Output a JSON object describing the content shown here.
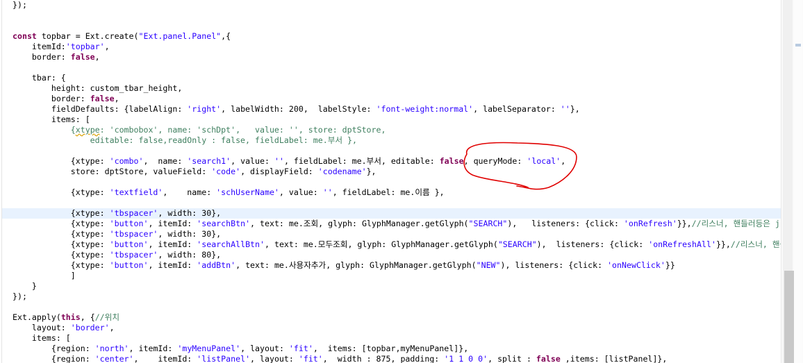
{
  "editor": {
    "lines": [
      {
        "segments": [
          {
            "t": "});",
            "c": "pl"
          }
        ]
      },
      {
        "segments": []
      },
      {
        "segments": []
      },
      {
        "segments": [
          {
            "t": "const",
            "c": "kw"
          },
          {
            "t": " topbar = Ext.create(",
            "c": "pl"
          },
          {
            "t": "\"Ext.panel.Panel\"",
            "c": "str"
          },
          {
            "t": ",{",
            "c": "pl"
          }
        ]
      },
      {
        "segments": [
          {
            "t": "    itemId:",
            "c": "pl"
          },
          {
            "t": "'topbar'",
            "c": "str"
          },
          {
            "t": ",",
            "c": "pl"
          }
        ]
      },
      {
        "segments": [
          {
            "t": "    border: ",
            "c": "pl"
          },
          {
            "t": "false",
            "c": "kw"
          },
          {
            "t": ",",
            "c": "pl"
          }
        ]
      },
      {
        "segments": []
      },
      {
        "segments": [
          {
            "t": "    tbar: {",
            "c": "pl"
          }
        ]
      },
      {
        "segments": [
          {
            "t": "        height: custom_tbar_height,",
            "c": "pl"
          }
        ]
      },
      {
        "segments": [
          {
            "t": "        border: ",
            "c": "pl"
          },
          {
            "t": "false",
            "c": "kw"
          },
          {
            "t": ",",
            "c": "pl"
          }
        ]
      },
      {
        "segments": [
          {
            "t": "        fieldDefaults: {labelAlign: ",
            "c": "pl"
          },
          {
            "t": "'right'",
            "c": "str"
          },
          {
            "t": ", labelWidth: 200,  labelStyle: ",
            "c": "pl"
          },
          {
            "t": "'font-weight:normal'",
            "c": "str"
          },
          {
            "t": ", labelSeparator: ",
            "c": "pl"
          },
          {
            "t": "''",
            "c": "str"
          },
          {
            "t": "},",
            "c": "pl"
          }
        ]
      },
      {
        "segments": [
          {
            "t": "        items: [",
            "c": "pl"
          }
        ]
      },
      {
        "segments": [
          {
            "t": "            {",
            "c": "cm"
          },
          {
            "t": "xtype",
            "c": "cmsq"
          },
          {
            "t": ": 'combobox', name: 'schDpt',   value: '', store: dptStore,",
            "c": "cm"
          }
        ]
      },
      {
        "segments": [
          {
            "t": "                editable: false,readOnly : false, fieldLabel: me.부서 },",
            "c": "cm"
          }
        ]
      },
      {
        "segments": []
      },
      {
        "segments": [
          {
            "t": "            {xtype: ",
            "c": "pl"
          },
          {
            "t": "'combo'",
            "c": "str"
          },
          {
            "t": ",  name: ",
            "c": "pl"
          },
          {
            "t": "'search1'",
            "c": "str"
          },
          {
            "t": ", value: ",
            "c": "pl"
          },
          {
            "t": "''",
            "c": "str"
          },
          {
            "t": ", fieldLabel: me.부서, editable: ",
            "c": "pl"
          },
          {
            "t": "false",
            "c": "kw"
          },
          {
            "t": ", queryMode: ",
            "c": "pl"
          },
          {
            "t": "'local'",
            "c": "str"
          },
          {
            "t": ",",
            "c": "pl"
          }
        ]
      },
      {
        "segments": [
          {
            "t": "            store: dptStore, valueField: ",
            "c": "pl"
          },
          {
            "t": "'code'",
            "c": "str"
          },
          {
            "t": ", displayField: ",
            "c": "pl"
          },
          {
            "t": "'codename'",
            "c": "str"
          },
          {
            "t": "},",
            "c": "pl"
          }
        ]
      },
      {
        "segments": []
      },
      {
        "segments": [
          {
            "t": "            {xtype: ",
            "c": "pl"
          },
          {
            "t": "'textfield'",
            "c": "str"
          },
          {
            "t": ",    name: ",
            "c": "pl"
          },
          {
            "t": "'schUserName'",
            "c": "str"
          },
          {
            "t": ", value: ",
            "c": "pl"
          },
          {
            "t": "''",
            "c": "str"
          },
          {
            "t": ", fieldLabel: me.이름 },",
            "c": "pl"
          }
        ]
      },
      {
        "segments": []
      },
      {
        "segments": [
          {
            "t": "            {xtype: ",
            "c": "pl"
          },
          {
            "t": "'tbspacer'",
            "c": "str"
          },
          {
            "t": ", width: 30},",
            "c": "pl"
          }
        ]
      },
      {
        "segments": [
          {
            "t": "            {xtype: ",
            "c": "pl"
          },
          {
            "t": "'button'",
            "c": "str"
          },
          {
            "t": ", itemId: ",
            "c": "pl"
          },
          {
            "t": "'searchBtn'",
            "c": "str"
          },
          {
            "t": ", text: me.조회, glyph: GlyphManager.getGlyph(",
            "c": "pl"
          },
          {
            "t": "\"SEARCH\"",
            "c": "str"
          },
          {
            "t": "),   listeners: {click: ",
            "c": "pl"
          },
          {
            "t": "'onRefresh'",
            "c": "str"
          },
          {
            "t": "}},",
            "c": "pl"
          },
          {
            "t": "//리스너, 핸들러등은 js",
            "c": "cm"
          }
        ]
      },
      {
        "segments": [
          {
            "t": "            {xtype: ",
            "c": "pl"
          },
          {
            "t": "'tbspacer'",
            "c": "str"
          },
          {
            "t": ", width: 30},",
            "c": "pl"
          }
        ]
      },
      {
        "segments": [
          {
            "t": "            {xtype: ",
            "c": "pl"
          },
          {
            "t": "'button'",
            "c": "str"
          },
          {
            "t": ", itemId: ",
            "c": "pl"
          },
          {
            "t": "'searchAllBtn'",
            "c": "str"
          },
          {
            "t": ", text: me.모두조회, glyph: GlyphManager.getGlyph(",
            "c": "pl"
          },
          {
            "t": "\"SEARCH\"",
            "c": "str"
          },
          {
            "t": "),  listeners: {click: ",
            "c": "pl"
          },
          {
            "t": "'onRefreshAll'",
            "c": "str"
          },
          {
            "t": "}},",
            "c": "pl"
          },
          {
            "t": "//리스너, 핸들",
            "c": "cm"
          }
        ]
      },
      {
        "segments": [
          {
            "t": "            {xtype: ",
            "c": "pl"
          },
          {
            "t": "'tbspacer'",
            "c": "str"
          },
          {
            "t": ", width: 80},",
            "c": "pl"
          }
        ]
      },
      {
        "segments": [
          {
            "t": "            {xtype: ",
            "c": "pl"
          },
          {
            "t": "'button'",
            "c": "str"
          },
          {
            "t": ", itemId: ",
            "c": "pl"
          },
          {
            "t": "'addBtn'",
            "c": "str"
          },
          {
            "t": ", text: me.사용자추가, glyph: GlyphManager.getGlyph(",
            "c": "pl"
          },
          {
            "t": "\"NEW\"",
            "c": "str"
          },
          {
            "t": "), listeners: {click: ",
            "c": "pl"
          },
          {
            "t": "'onNewClick'",
            "c": "str"
          },
          {
            "t": "}}",
            "c": "pl"
          }
        ]
      },
      {
        "segments": [
          {
            "t": "            ]",
            "c": "pl"
          }
        ]
      },
      {
        "segments": [
          {
            "t": "    }",
            "c": "pl"
          }
        ]
      },
      {
        "segments": [
          {
            "t": "});",
            "c": "pl"
          }
        ]
      },
      {
        "segments": []
      },
      {
        "segments": [
          {
            "t": "Ext.apply(",
            "c": "pl"
          },
          {
            "t": "this",
            "c": "kw"
          },
          {
            "t": ", {",
            "c": "pl"
          },
          {
            "t": "//위치",
            "c": "cm"
          }
        ]
      },
      {
        "segments": [
          {
            "t": "    layout: ",
            "c": "pl"
          },
          {
            "t": "'border'",
            "c": "str"
          },
          {
            "t": ",",
            "c": "pl"
          }
        ]
      },
      {
        "segments": [
          {
            "t": "    items: [",
            "c": "pl"
          }
        ]
      },
      {
        "segments": [
          {
            "t": "        {region: ",
            "c": "pl"
          },
          {
            "t": "'north'",
            "c": "str"
          },
          {
            "t": ", itemId: ",
            "c": "pl"
          },
          {
            "t": "'myMenuPanel'",
            "c": "str"
          },
          {
            "t": ", layout: ",
            "c": "pl"
          },
          {
            "t": "'fit'",
            "c": "str"
          },
          {
            "t": ",  items: [topbar,myMenuPanel]},",
            "c": "pl"
          }
        ]
      },
      {
        "segments": [
          {
            "t": "        {region: ",
            "c": "pl"
          },
          {
            "t": "'center'",
            "c": "str"
          },
          {
            "t": ",    itemId: ",
            "c": "pl"
          },
          {
            "t": "'listPanel'",
            "c": "str"
          },
          {
            "t": ", layout: ",
            "c": "pl"
          },
          {
            "t": "'fit'",
            "c": "str"
          },
          {
            "t": ",  width : 875, padding: ",
            "c": "pl"
          },
          {
            "t": "'1 1 0 0'",
            "c": "str"
          },
          {
            "t": ", split : ",
            "c": "pl"
          },
          {
            "t": "false",
            "c": "kw"
          },
          {
            "t": " ,items: [listPanel]},",
            "c": "pl"
          }
        ]
      }
    ],
    "current_line_index": 20,
    "colors": {
      "keyword": "#7f0055",
      "string": "#2a00ff",
      "comment": "#3f7f5f",
      "plain": "#000000",
      "current_line": "#e8f2fe",
      "annotation": "#e00000"
    }
  }
}
